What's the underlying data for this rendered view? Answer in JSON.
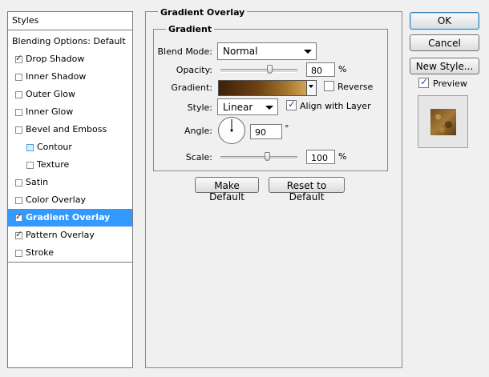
{
  "styles_panel": {
    "header": "Styles",
    "blending_options": "Blending Options: Default",
    "items": [
      {
        "label": "Drop Shadow",
        "checked": true,
        "indent": false,
        "selected": false
      },
      {
        "label": "Inner Shadow",
        "checked": false,
        "indent": false,
        "selected": false
      },
      {
        "label": "Outer Glow",
        "checked": false,
        "indent": false,
        "selected": false
      },
      {
        "label": "Inner Glow",
        "checked": false,
        "indent": false,
        "selected": false
      },
      {
        "label": "Bevel and Emboss",
        "checked": false,
        "indent": false,
        "selected": false
      },
      {
        "label": "Contour",
        "checked": false,
        "indent": true,
        "selected": false
      },
      {
        "label": "Texture",
        "checked": false,
        "indent": true,
        "selected": false
      },
      {
        "label": "Satin",
        "checked": false,
        "indent": false,
        "selected": false
      },
      {
        "label": "Color Overlay",
        "checked": false,
        "indent": false,
        "selected": false
      },
      {
        "label": "Gradient Overlay",
        "checked": true,
        "indent": false,
        "selected": true
      },
      {
        "label": "Pattern Overlay",
        "checked": true,
        "indent": false,
        "selected": false
      },
      {
        "label": "Stroke",
        "checked": false,
        "indent": false,
        "selected": false
      }
    ]
  },
  "gradient_overlay": {
    "section_title": "Gradient Overlay",
    "group_title": "Gradient",
    "blend_mode_label": "Blend Mode:",
    "blend_mode_value": "Normal",
    "opacity_label": "Opacity:",
    "opacity_value": "80",
    "opacity_percent": 80,
    "opacity_unit": "%",
    "gradient_label": "Gradient:",
    "reverse_label": "Reverse",
    "reverse_checked": false,
    "style_label": "Style:",
    "style_value": "Linear",
    "align_label": "Align with Layer",
    "align_checked": true,
    "angle_label": "Angle:",
    "angle_value": "90",
    "angle_degrees": 90,
    "angle_unit": "°",
    "scale_label": "Scale:",
    "scale_value": "100",
    "scale_percent": 100,
    "scale_unit": "%",
    "make_default_label": "Make Default",
    "reset_default_label": "Reset to Default"
  },
  "actions": {
    "ok_label": "OK",
    "cancel_label": "Cancel",
    "new_style_label": "New Style...",
    "preview_label": "Preview",
    "preview_checked": true
  },
  "colors": {
    "selection": "#3399ff",
    "gradient_start": "#3d2008",
    "gradient_end": "#d2a555"
  }
}
